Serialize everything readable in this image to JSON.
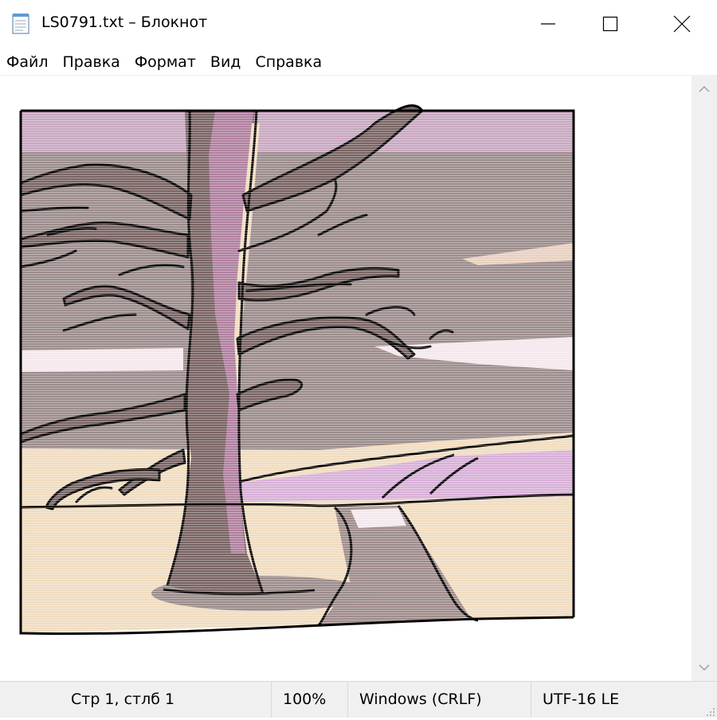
{
  "window": {
    "title": "LS0791.txt – Блокнот",
    "icon": "notepad-icon",
    "controls": [
      "minimize-icon",
      "maximize-icon",
      "close-icon"
    ]
  },
  "menu": {
    "file": "Файл",
    "edit": "Правка",
    "format": "Формат",
    "view": "Вид",
    "help": "Справка"
  },
  "editor": {
    "content_description": "ASCII-art",
    "palette": {
      "sky": "#9c8c8c",
      "sky_top": "#c8a8c0",
      "trunk": "#7a6464",
      "trunk_light": "#b080a0",
      "ground": "#f0dcc0",
      "lilac": "#d8b0d8",
      "outline": "#000000"
    }
  },
  "status": {
    "position": "Стр 1, стлб 1",
    "zoom": "100%",
    "line_endings": "Windows (CRLF)",
    "encoding": "UTF-16 LE"
  },
  "scrollbar": {
    "up_icon": "chevron-up-icon",
    "down_icon": "chevron-down-icon"
  }
}
